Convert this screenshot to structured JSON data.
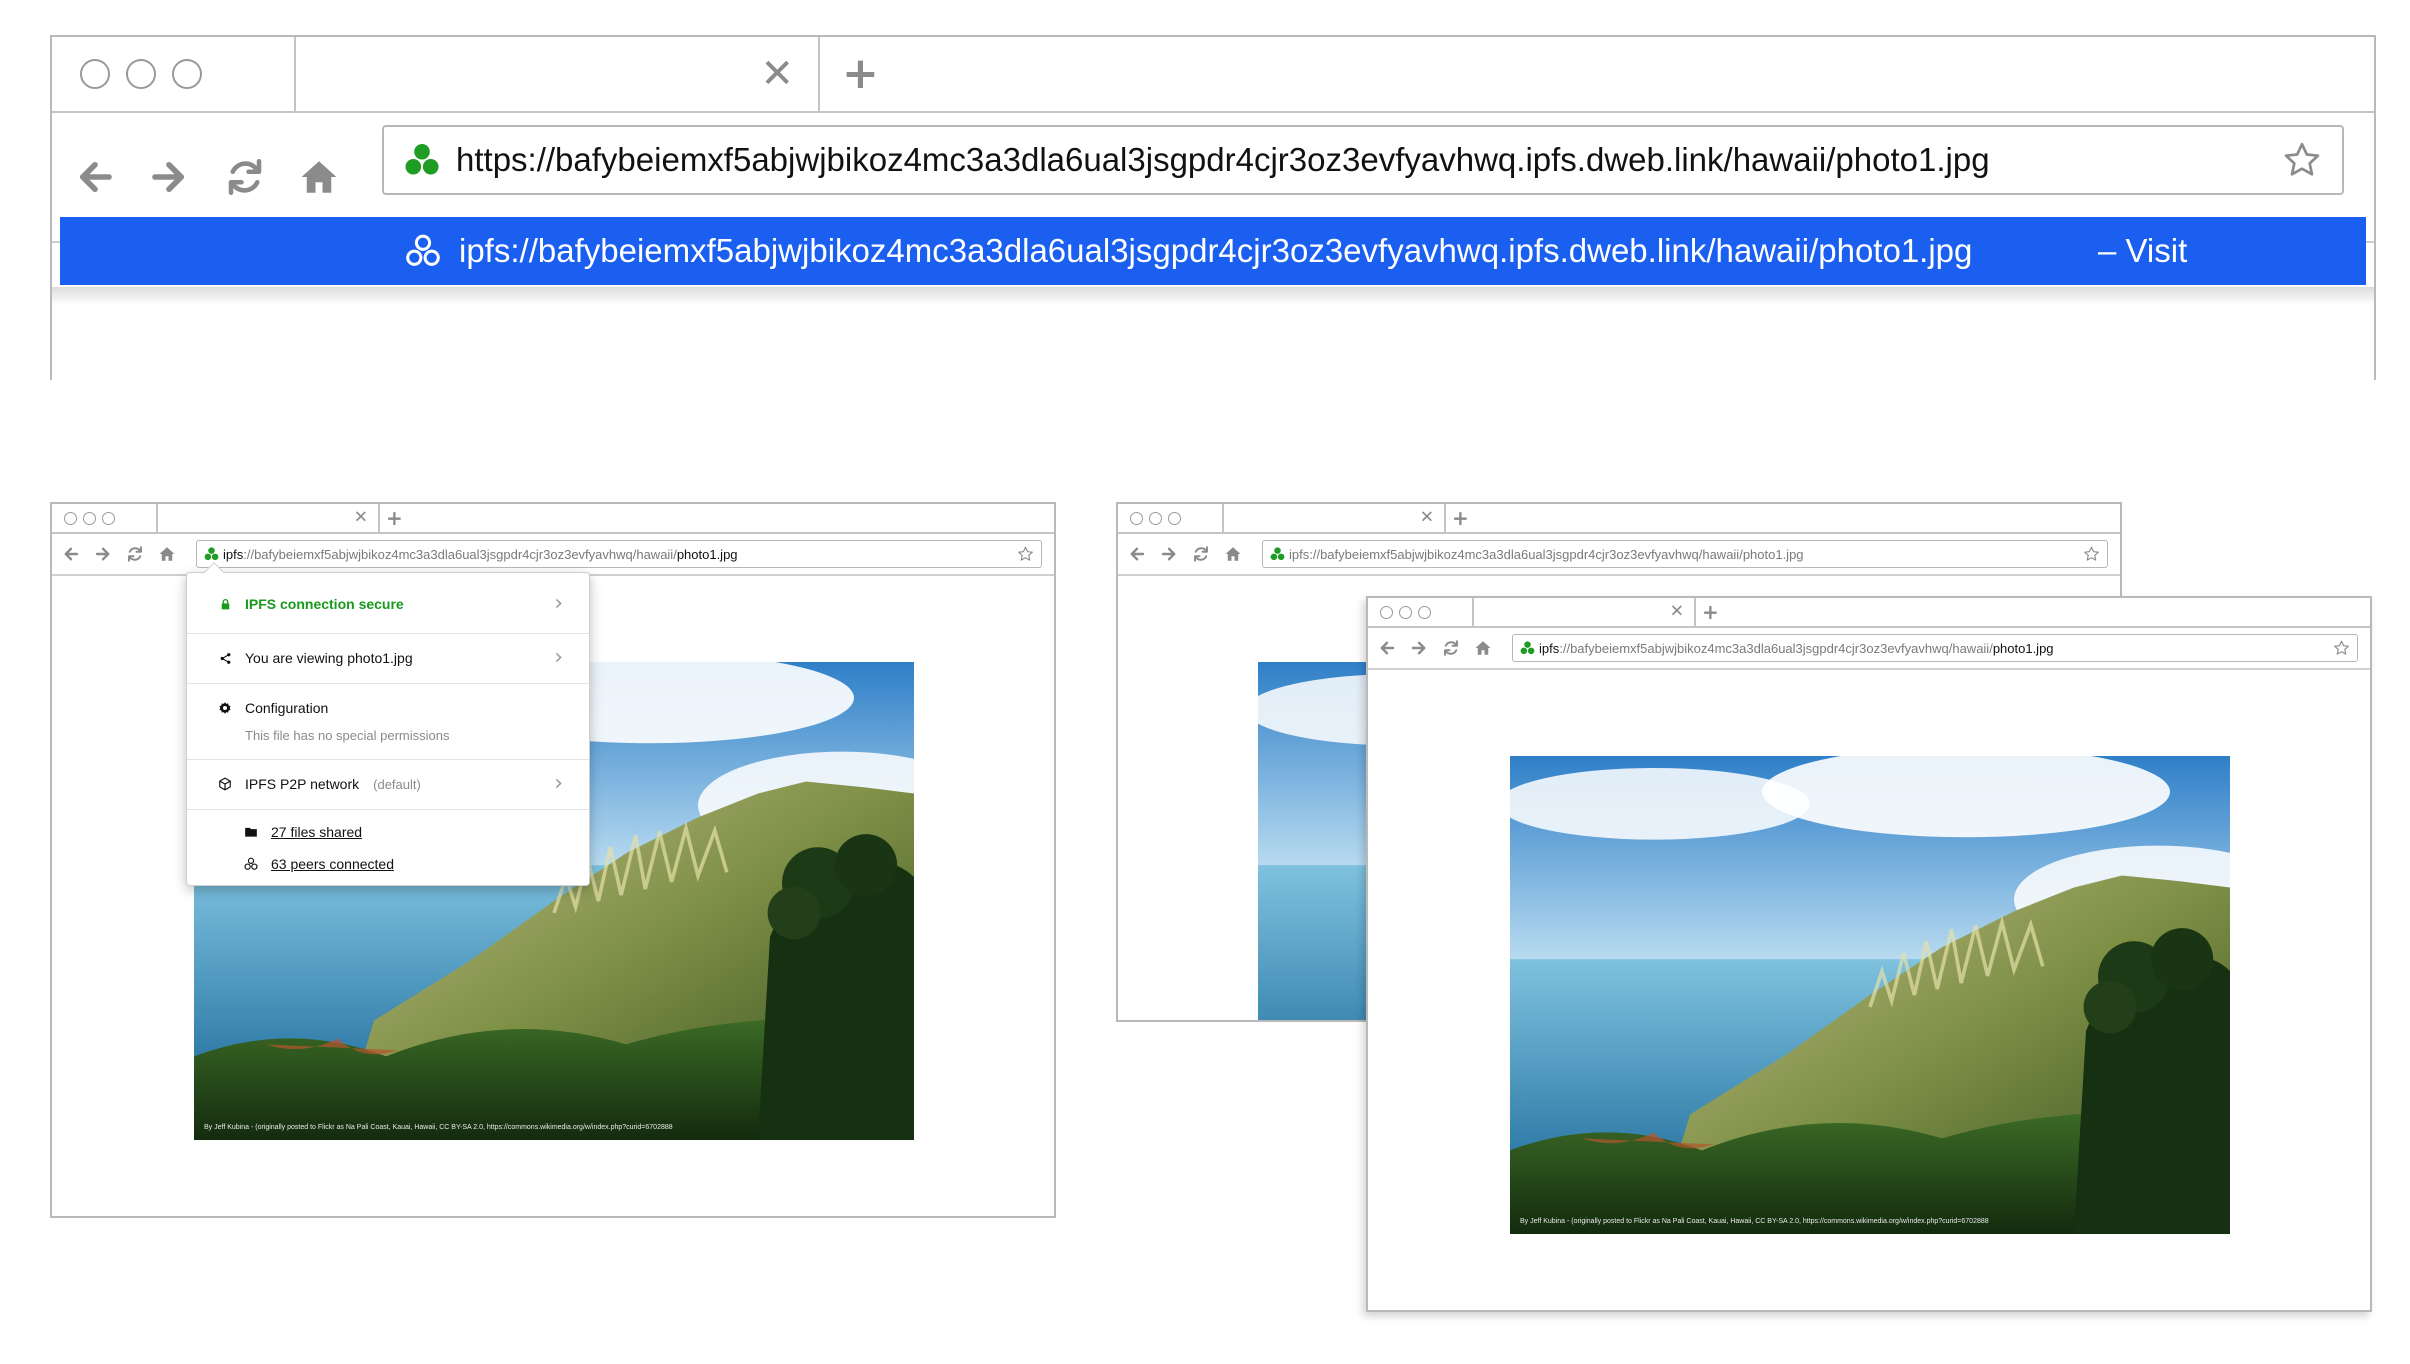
{
  "colors": {
    "ipfs_green": "#1f9c24",
    "suggestion_blue": "#1a5ff0",
    "chrome_border": "#b9b9b9"
  },
  "big_browser": {
    "url": "https://bafybeiemxf5abjwjbikoz4mc3a3dla6ual3jsgpdr4cjr3oz3evfyavhwq.ipfs.dweb.link/hawaii/photo1.jpg",
    "suggestion": {
      "url": "ipfs://bafybeiemxf5abjwjbikoz4mc3a3dla6ual3jsgpdr4cjr3oz3evfyavhwq.ipfs.dweb.link/hawaii/photo1.jpg",
      "action": "– Visit"
    },
    "icons": [
      "back-arrow-icon",
      "forward-arrow-icon",
      "reload-icon",
      "home-icon",
      "ipfs-icon",
      "star-icon"
    ]
  },
  "small_browser_url": {
    "scheme": "ipfs",
    "path": "://bafybeiemxf5abjwjbikoz4mc3a3dla6ual3jsgpdr4cjr3oz3evfyavhwq/hawaii/",
    "file": "photo1.jpg"
  },
  "site_panel": {
    "secure": "IPFS connection secure",
    "viewing": "You are viewing photo1.jpg",
    "config_title": "Configuration",
    "config_sub": "This file has no special permissions",
    "network": "IPFS P2P network",
    "network_tag": "(default)",
    "files_shared": "27 files shared",
    "peers_connected": "63 peers connected"
  },
  "photo_credit": "By Jeff Kubina - (originally posted to Flickr as Na Pali Coast, Kauai, Hawaii, CC BY-SA 2.0, https://commons.wikimedia.org/w/index.php?curid=6702888"
}
